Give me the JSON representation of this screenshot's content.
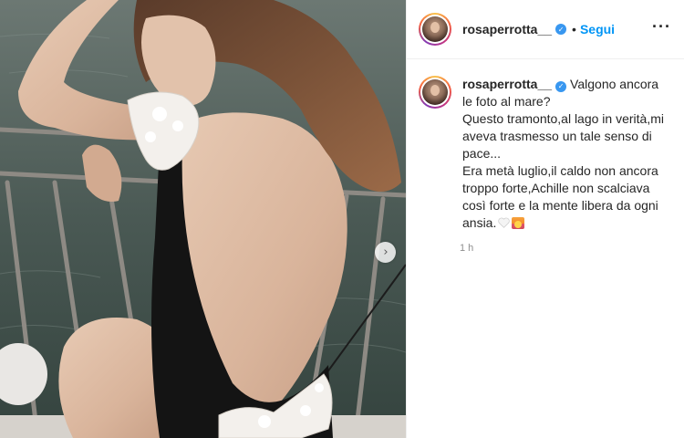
{
  "post": {
    "username": "rosaperrotta__",
    "follow_label": "Segui",
    "dot": "•",
    "more_icon": "···",
    "verified_icon": "verified-badge-icon",
    "caption_text": "Valgono ancora le foto al mare?\nQuesto tramonto,al lago in verità,mi aveva trasmesso un tale senso di pace...\nEra metà luglio,il caldo non ancora troppo forte,Achille non scalciava così forte e la mente libera da ogni ansia.",
    "emojis": [
      "white-heart-emoji",
      "sunset-emoji"
    ],
    "timestamp": "1 h",
    "next_icon": "›"
  },
  "colors": {
    "accent": "#0095f6",
    "verified": "#3897f0",
    "text": "#262626",
    "muted": "#8e8e8e"
  }
}
